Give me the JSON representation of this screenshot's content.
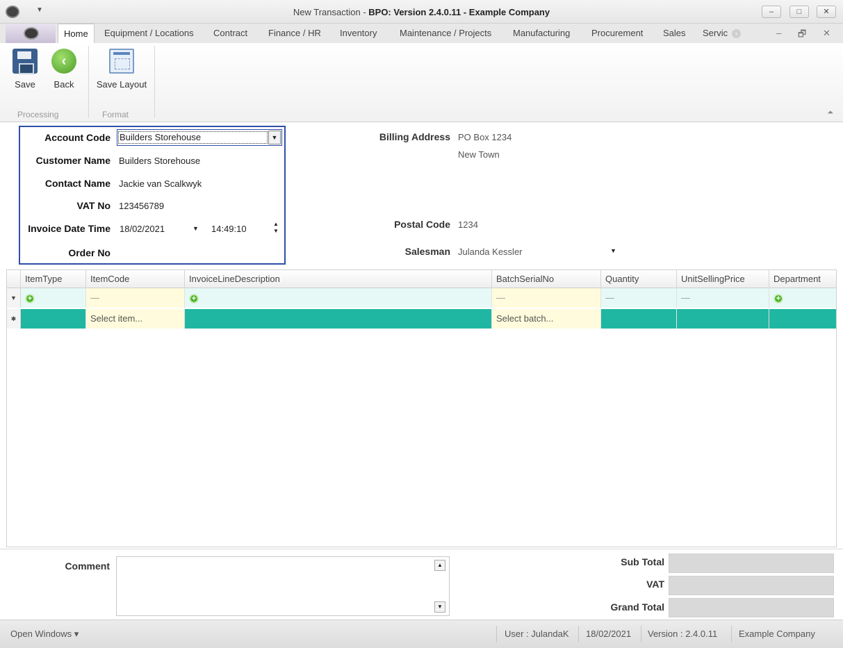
{
  "window": {
    "title_plain": "New Transaction - ",
    "title_bold": "BPO: Version 2.4.0.11 - Example Company",
    "minimize": "–",
    "maximize": "□",
    "close": "✕"
  },
  "ribbon": {
    "tabs": [
      "Home",
      "Equipment / Locations",
      "Contract",
      "Finance / HR",
      "Inventory",
      "Maintenance / Projects",
      "Manufacturing",
      "Procurement",
      "Sales",
      "Servic"
    ],
    "buttons": {
      "save": "Save",
      "back": "Back",
      "save_layout": "Save Layout"
    },
    "groups": {
      "processing": "Processing",
      "format": "Format"
    },
    "mdi_min": "–",
    "mdi_restore": "🗗",
    "mdi_close": "✕"
  },
  "form": {
    "labels": {
      "account_code": "Account Code",
      "customer_name": "Customer Name",
      "contact_name": "Contact Name",
      "vat_no": "VAT No",
      "invoice_date_time": "Invoice Date Time",
      "order_no": "Order No",
      "billing_address": "Billing Address",
      "postal_code": "Postal Code",
      "salesman": "Salesman"
    },
    "values": {
      "account_code": "Builders Storehouse",
      "customer_name": "Builders Storehouse",
      "contact_name": "Jackie van Scalkwyk",
      "vat_no": "123456789",
      "invoice_date": "18/02/2021",
      "invoice_time": "14:49:10",
      "order_no": "",
      "billing_address_line1": "PO Box 1234",
      "billing_address_line2": "New Town",
      "postal_code": "1234",
      "salesman": "Julanda Kessler"
    }
  },
  "grid": {
    "columns": [
      "ItemType",
      "ItemCode",
      "InvoiceLineDescription",
      "BatchSerialNo",
      "Quantity",
      "UnitSellingPrice",
      "Department"
    ],
    "new_row": {
      "item_code_placeholder": "Select item...",
      "batch_placeholder": "Select batch..."
    },
    "filter_dash": "—"
  },
  "footer": {
    "comment_label": "Comment",
    "comment_value": "",
    "sub_total_label": "Sub Total",
    "vat_label": "VAT",
    "grand_total_label": "Grand Total"
  },
  "statusbar": {
    "open_windows": "Open Windows ▾",
    "user": "User : JulandaK",
    "date": "18/02/2021",
    "version": "Version : 2.4.0.11",
    "company": "Example Company"
  },
  "colors": {
    "focus_border": "#2f4ea8",
    "new_row_teal": "#1fb7a2",
    "filter_row": "#e6f9f7",
    "placeholder_yellow": "#fffbdc"
  }
}
